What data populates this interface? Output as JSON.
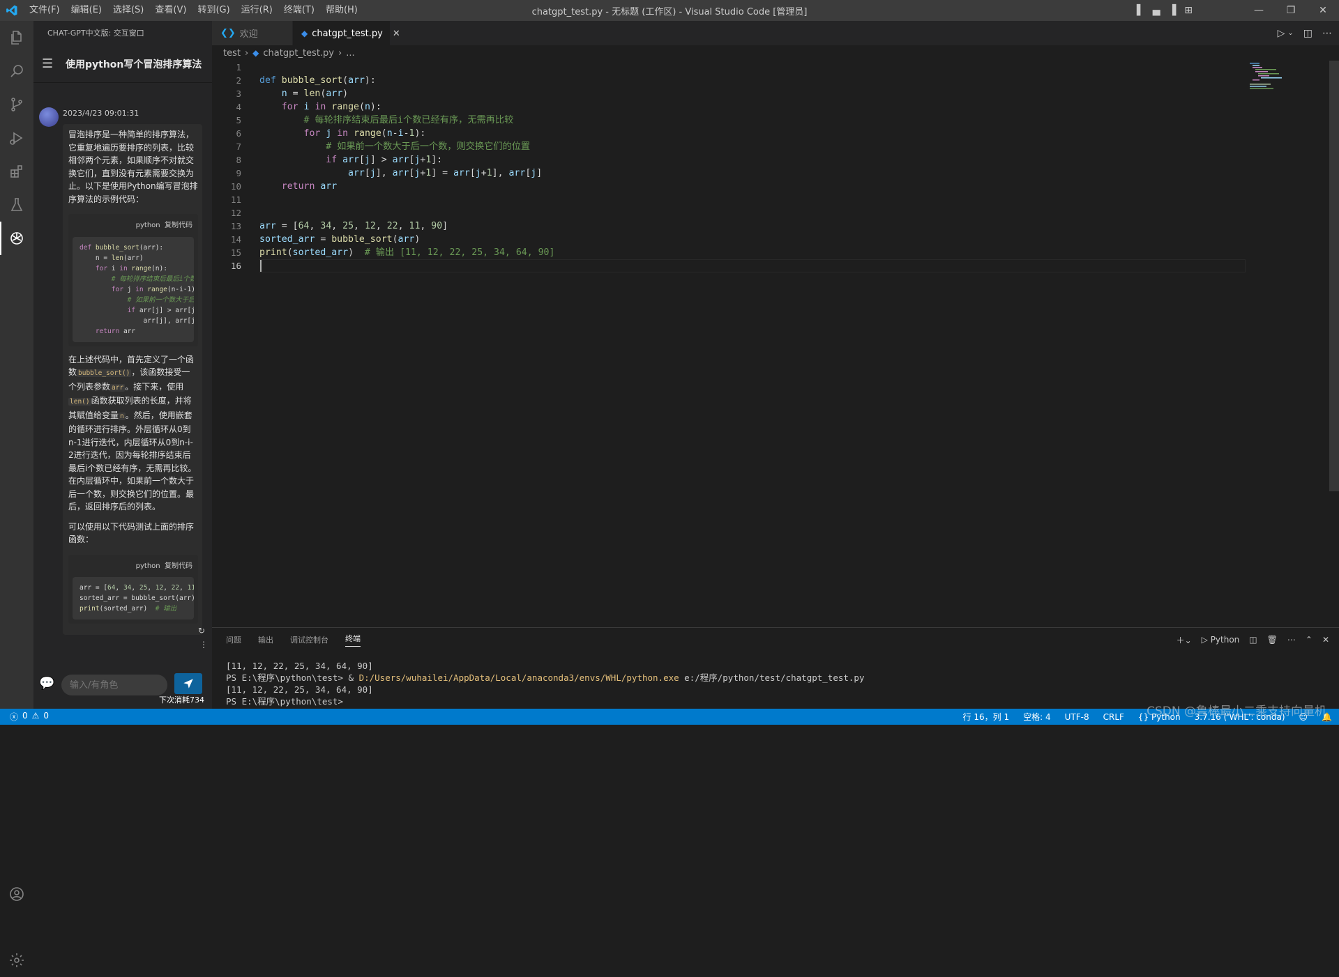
{
  "titlebar": {
    "menu": [
      "文件(F)",
      "编辑(E)",
      "选择(S)",
      "查看(V)",
      "转到(G)",
      "运行(R)",
      "终端(T)",
      "帮助(H)"
    ],
    "title": "chatgpt_test.py - 无标题 (工作区) - Visual Studio Code [管理员]"
  },
  "sidebar": {
    "header": "CHAT-GPT中文版: 交互窗口",
    "conversation_title": "使用python写个冒泡排序算法",
    "message": {
      "time": "2023/4/23 09:01:31",
      "para1": "冒泡排序是一种简单的排序算法，它重复地遍历要排序的列表，比较相邻两个元素，如果顺序不对就交换它们，直到没有元素需要交换为止。以下是使用Python编写冒泡排序算法的示例代码：",
      "code1_lang": "python",
      "code1_copy": "复制代码",
      "p2_a": "在上述代码中，首先定义了一个函数",
      "p2_code1": "bubble_sort()",
      "p2_b": "，该函数接受一个列表参数",
      "p2_code2": "arr",
      "p2_c": "。接下来，使用",
      "p2_code3": "len()",
      "p2_d": "函数获取列表的长度，并将其赋值给变量",
      "p2_code4": "n",
      "p2_e": "。然后，使用嵌套的循环进行排序。外层循环从0到n-1进行迭代，内层循环从0到n-i-2进行迭代，因为每轮排序结束后最后i个数已经有序，无需再比较。在内层循环中，如果前一个数大于后一个数，则交换它们的位置。最后，返回排序后的列表。",
      "para3": "可以使用以下代码测试上面的排序函数：",
      "code2_lang": "python",
      "code2_copy": "复制代码"
    },
    "input_placeholder": "输入/有角色",
    "cost_text": "下次消耗734"
  },
  "editor": {
    "tabs": [
      {
        "label": "欢迎"
      },
      {
        "label": "chatgpt_test.py"
      }
    ],
    "breadcrumb": {
      "folder": "test",
      "file": "chatgpt_test.py",
      "more": "..."
    },
    "line_numbers": [
      "1",
      "2",
      "3",
      "4",
      "5",
      "6",
      "7",
      "8",
      "9",
      "10",
      "11",
      "12",
      "13",
      "14",
      "15",
      "16"
    ],
    "comments": {
      "c1": "# 每轮排序结束后最后i个数已经有序，无需再比较",
      "c2": "# 如果前一个数大于后一个数，则交换它们的位置",
      "c3": "# 输出 [11, 12, 22, 25, 34, 64, 90]"
    }
  },
  "panel": {
    "tabs": [
      "问题",
      "输出",
      "调试控制台",
      "终端"
    ],
    "shell_label": "Python",
    "terminal_lines": [
      "[11, 12, 22, 25, 34, 64, 90]",
      "PS E:\\程序\\python\\test> & ",
      "D:/Users/wuhailei/AppData/Local/anaconda3/envs/WHL/python.exe",
      " e:/程序/python/test/chatgpt_test.py",
      "[11, 12, 22, 25, 34, 64, 90]",
      "PS E:\\程序\\python\\test>"
    ]
  },
  "statusbar": {
    "errors": "0",
    "warnings": "0",
    "position": "行 16，列 1",
    "spaces": "空格: 4",
    "encoding": "UTF-8",
    "eol": "CRLF",
    "language": "Python",
    "interpreter": "3.7.16 ('WHL': conda)"
  },
  "watermark": "CSDN @鲁棒最小二乘支持向量机",
  "colors": {
    "accent": "#007acc",
    "titlebar": "#3c3c3c",
    "editor_bg": "#1e1e1e"
  }
}
